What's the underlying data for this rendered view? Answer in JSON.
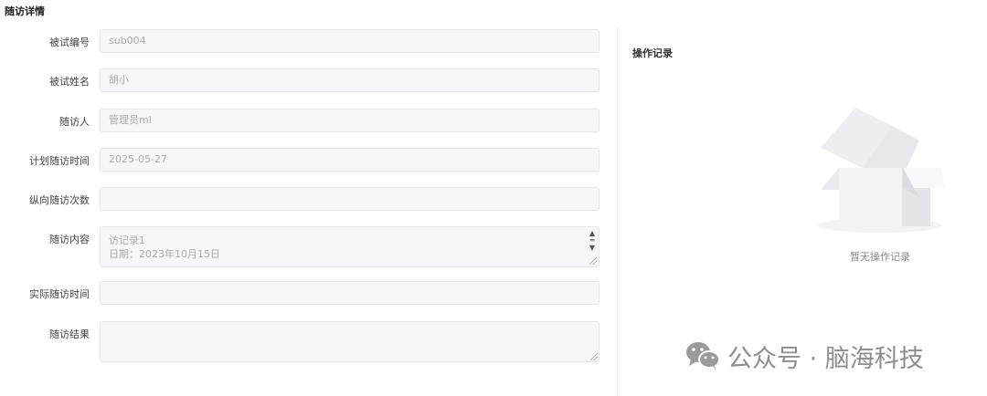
{
  "page": {
    "title": "随访详情"
  },
  "form": {
    "fields": [
      {
        "label": "被试编号",
        "value": "sub004"
      },
      {
        "label": "被试姓名",
        "value": "胡小"
      },
      {
        "label": "随访人",
        "value": "管理员ml"
      },
      {
        "label": "计划随访时间",
        "value": "2025-05-27"
      },
      {
        "label": "纵向随访次数",
        "value": ""
      },
      {
        "label": "随访内容",
        "value_line1": "访记录1",
        "value_line2": "日期：2023年10月15日"
      },
      {
        "label": "实际随访时间",
        "value": ""
      },
      {
        "label": "随访结果",
        "value": ""
      }
    ]
  },
  "operations": {
    "title": "操作记录",
    "empty_text": "暂无操作记录",
    "empty_icon": "empty-box-icon"
  },
  "watermark": {
    "text": "公众号 · 脑海科技",
    "icon": "wechat-icon"
  }
}
